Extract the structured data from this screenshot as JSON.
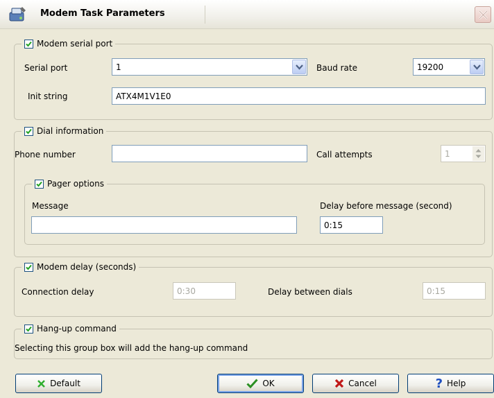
{
  "window": {
    "title": "Modem Task Parameters"
  },
  "modem_serial_port": {
    "legend": "Modem serial port",
    "checked": true,
    "serial_port_label": "Serial port",
    "serial_port_value": "1",
    "baud_rate_label": "Baud rate",
    "baud_rate_value": "19200",
    "init_string_label": "Init string",
    "init_string_value": "ATX4M1V1E0"
  },
  "dial_information": {
    "legend": "Dial information",
    "checked": true,
    "phone_number_label": "Phone number",
    "phone_number_value": "",
    "call_attempts_label": "Call attempts",
    "call_attempts_value": "1",
    "pager_options": {
      "legend": "Pager options",
      "checked": true,
      "message_label": "Message",
      "message_value": "",
      "delay_label": "Delay before message (second)",
      "delay_value": "0:15"
    }
  },
  "modem_delay": {
    "legend": "Modem delay (seconds)",
    "checked": true,
    "connection_delay_label": "Connection delay",
    "connection_delay_value": "0:30",
    "delay_between_dials_label": "Delay between dials",
    "delay_between_dials_value": "0:15"
  },
  "hang_up": {
    "legend": "Hang-up command",
    "checked": true,
    "description": "Selecting this group box will add the hang-up command"
  },
  "buttons": {
    "default": "Default",
    "ok": "OK",
    "cancel": "Cancel",
    "help": "Help"
  },
  "colors": {
    "check": "#21a121",
    "cancel_x": "#c01818",
    "default_x": "#2fae2f",
    "help": "#1f4fbf"
  }
}
